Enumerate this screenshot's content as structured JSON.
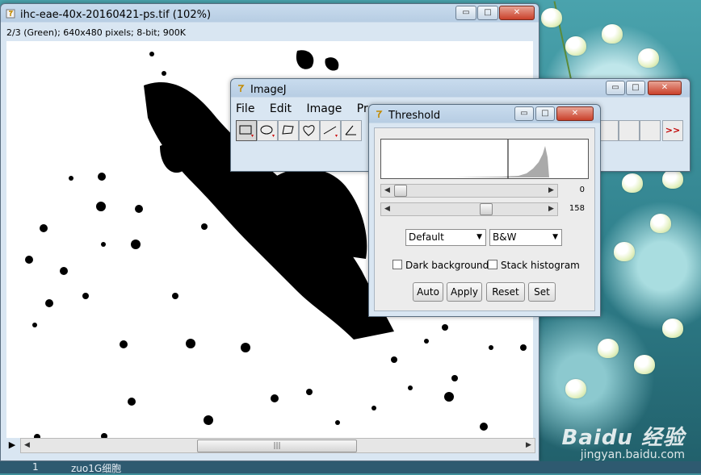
{
  "image_window": {
    "title": "ihc-eae-40x-20160421-ps.tif (102%)",
    "status": "2/3 (Green); 640x480 pixels; 8-bit; 900K",
    "controls": {
      "minimize": "▭",
      "maximize": "□",
      "close": "✕"
    },
    "scrollbar": {
      "left_arrow": "◀",
      "right_arrow": "▶",
      "thumb_grip": "|||",
      "play": "▶"
    }
  },
  "imagej": {
    "title": "ImageJ",
    "menus": [
      "File",
      "Edit",
      "Image",
      "Proc"
    ],
    "tools": [
      "rectangle-tool",
      "oval-tool",
      "polygon-tool",
      "freehand-tool",
      "line-tool",
      "angle-tool"
    ],
    "more_tools_label": ">>",
    "controls": {
      "minimize": "▭",
      "maximize": "□",
      "close": "✕"
    }
  },
  "threshold": {
    "title": "Threshold",
    "slider_min_value": "0",
    "slider_max_value": "158",
    "method_select": "Default",
    "mode_select": "B&W",
    "dark_background_label": "Dark background",
    "stack_histogram_label": "Stack histogram",
    "buttons": {
      "auto": "Auto",
      "apply": "Apply",
      "reset": "Reset",
      "set": "Set"
    },
    "controls": {
      "minimize": "▭",
      "maximize": "□",
      "close": "✕"
    },
    "colors": {
      "histogram_fill": "#aaaaaa",
      "threshold_line": "#000000"
    }
  },
  "desktop": {
    "watermark_logo": "Baidu 经验",
    "watermark_url": "jingyan.baidu.com"
  },
  "taskbar": {
    "number": "1",
    "item": "zuo1G细胞"
  }
}
